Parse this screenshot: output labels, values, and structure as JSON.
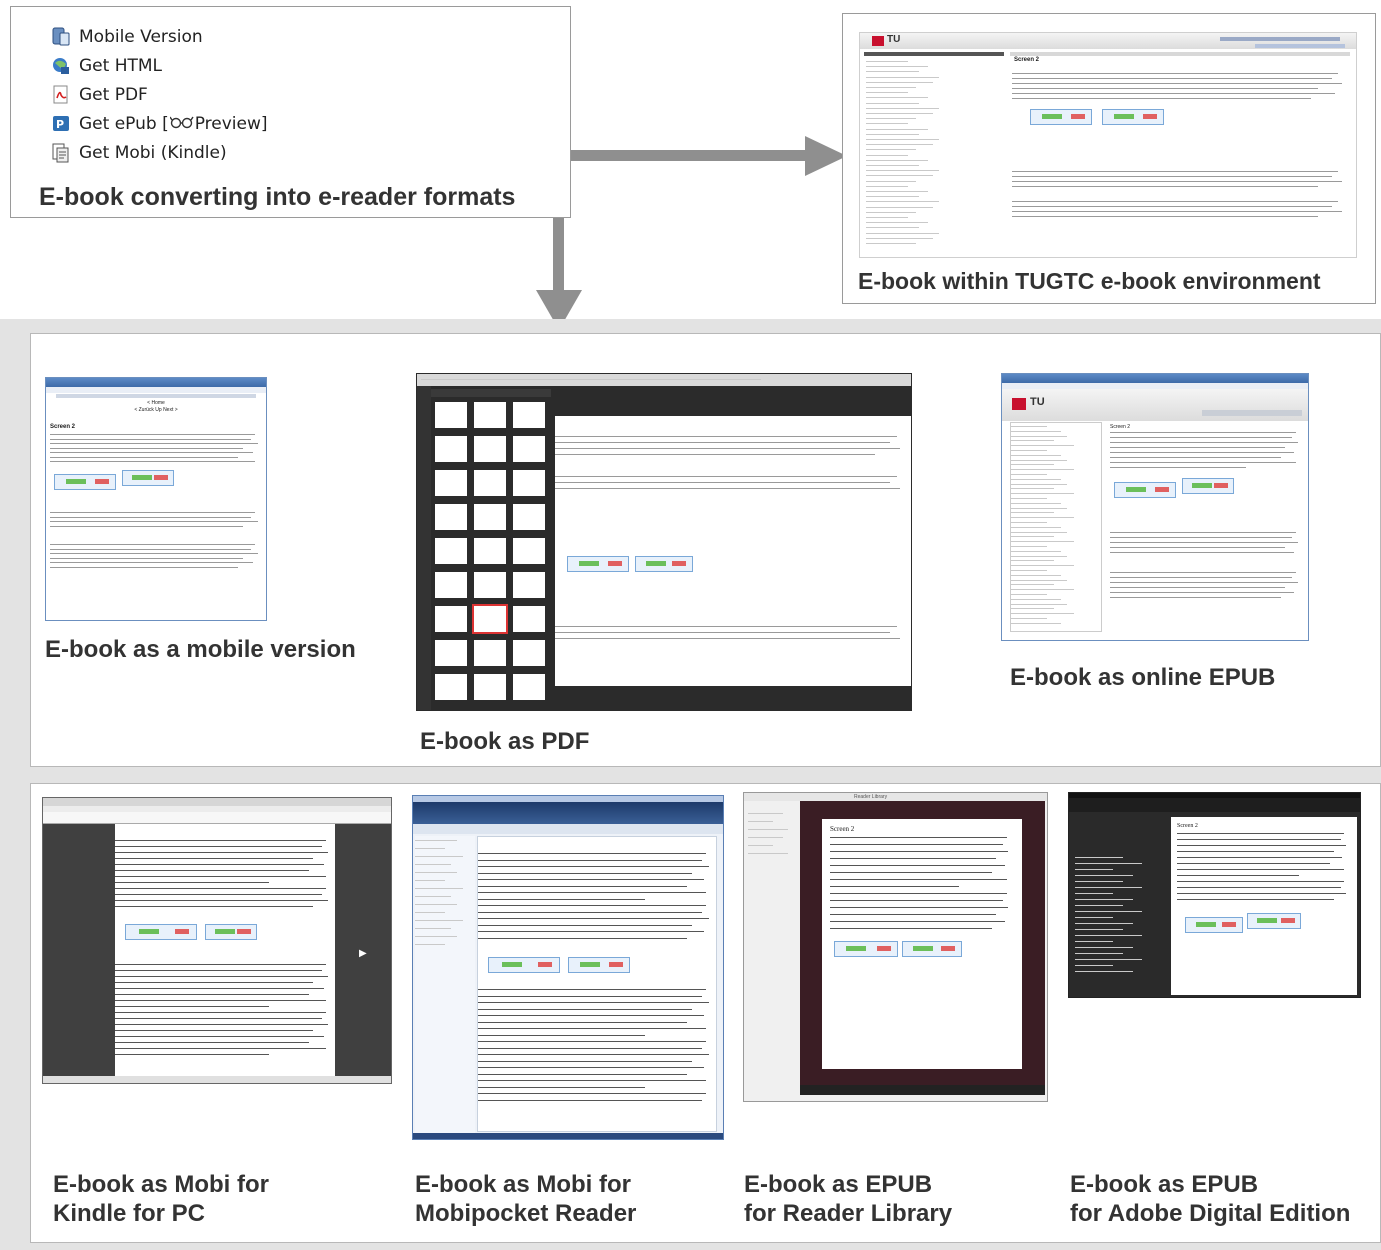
{
  "download_menu": {
    "items": [
      {
        "label": "Mobile Version",
        "icon": "mobile-icon"
      },
      {
        "label": "Get HTML",
        "icon": "html-icon"
      },
      {
        "label": "Get PDF",
        "icon": "pdf-icon"
      },
      {
        "label": "Get ePub [",
        "icon": "epub-icon",
        "preview_label": "Preview]"
      },
      {
        "label": "Get Mobi (Kindle)",
        "icon": "mobi-icon"
      }
    ],
    "caption": "E-book converting into e-reader formats"
  },
  "environment": {
    "caption": "E-book within TUGTC e-book environment",
    "logo_text": "TU",
    "screen_title": "Screen 2"
  },
  "row_formats": {
    "mobile": {
      "caption": "E-book as a mobile version",
      "nav_home": "< Home",
      "nav_back": "< Zurück  Up  Next >",
      "screen_title": "Screen 2"
    },
    "pdf": {
      "caption": "E-book as PDF",
      "hinweis": "Hinweis:"
    },
    "online_epub": {
      "caption": "E-book as online EPUB",
      "logo_text": "TU",
      "screen_title": "Screen 2",
      "hinweis": "Hinweis:"
    }
  },
  "row_readers": {
    "kindle_pc": {
      "caption_line1": "E-book as Mobi for",
      "caption_line2": "Kindle for PC",
      "screen_title": "Screen 2",
      "hinweis": "Hinweis:"
    },
    "mobipocket": {
      "caption_line1": "E-book as Mobi for",
      "caption_line2": "Mobipocket Reader",
      "hinweis": "Hinweis:"
    },
    "reader_library": {
      "caption_line1": "E-book as EPUB",
      "caption_line2": "for Reader Library",
      "screen_title": "Screen 2",
      "app_title": "Reader Library"
    },
    "adobe_de": {
      "caption_line1": "E-book as EPUB",
      "caption_line2": "for Adobe Digital Edition",
      "screen_title": "Screen 2"
    }
  },
  "colors": {
    "arrow": "#8f8f8f",
    "band": "#e3e3e3",
    "caption": "#333333",
    "tu_red": "#c8102e"
  }
}
